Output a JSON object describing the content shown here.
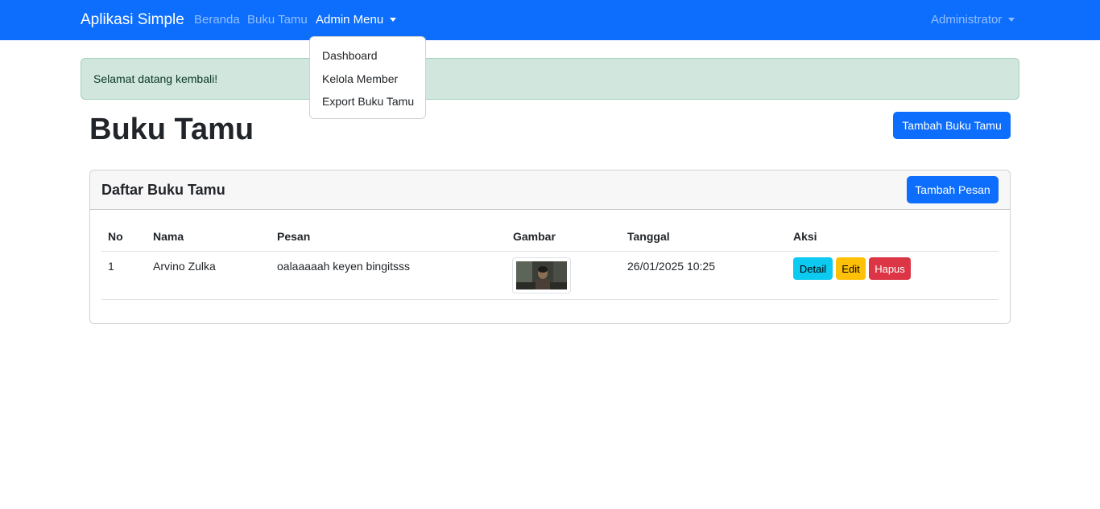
{
  "navbar": {
    "brand": "Aplikasi Simple",
    "links": [
      "Beranda",
      "Buku Tamu"
    ],
    "admin_menu": "Admin Menu",
    "user_menu": "Administrator"
  },
  "dropdown": {
    "items": [
      "Dashboard",
      "Kelola Member",
      "Export Buku Tamu"
    ]
  },
  "alert": {
    "text": "Selamat datang kembali!"
  },
  "page": {
    "title": "Buku Tamu",
    "add_book_button": "Tambah Buku Tamu"
  },
  "card": {
    "title": "Daftar Buku Tamu",
    "add_message_button": "Tambah Pesan"
  },
  "table": {
    "headers": [
      "No",
      "Nama",
      "Pesan",
      "Gambar",
      "Tanggal",
      "Aksi"
    ],
    "rows": [
      {
        "no": "1",
        "nama": "Arvino Zulka",
        "pesan": "oalaaaaah keyen bingitsss",
        "tanggal": "26/01/2025 10:25",
        "actions": [
          "Detail",
          "Edit",
          "Hapus"
        ]
      }
    ]
  },
  "colors": {
    "primary": "#0d6efd",
    "success_bg": "#d1e7dd",
    "info": "#0dcaf0",
    "warning": "#ffc107",
    "danger": "#dc3545"
  }
}
